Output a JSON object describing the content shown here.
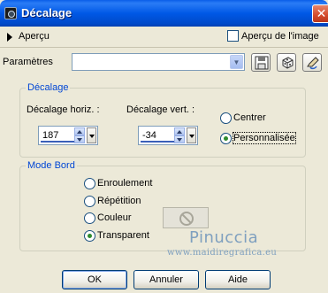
{
  "window": {
    "title": "Décalage",
    "close_glyph": "✕"
  },
  "preview": {
    "toggle_label": "Aperçu",
    "checkbox_label": "Aperçu de l'image",
    "checkbox_checked": false
  },
  "params": {
    "label": "Paramètres",
    "combo_value": "",
    "buttons": [
      "save-icon",
      "dice-icon",
      "reset-icon"
    ]
  },
  "offset": {
    "group_title": "Décalage",
    "horiz_label": "Décalage horiz. :",
    "horiz_value": "187",
    "vert_label": "Décalage vert. :",
    "vert_value": "-34",
    "options": [
      {
        "label": "Centrer",
        "checked": false
      },
      {
        "label": "Personnalisée",
        "checked": true
      }
    ]
  },
  "edge_mode": {
    "group_title": "Mode Bord",
    "options": [
      {
        "label": "Enroulement",
        "checked": false
      },
      {
        "label": "Répétition",
        "checked": false
      },
      {
        "label": "Couleur",
        "checked": false
      },
      {
        "label": "Transparent",
        "checked": true
      }
    ]
  },
  "watermark": {
    "name": "Pinuccia",
    "url": "www.maidiregrafica.eu"
  },
  "footer": {
    "ok": "OK",
    "cancel": "Annuler",
    "help": "Aide"
  }
}
